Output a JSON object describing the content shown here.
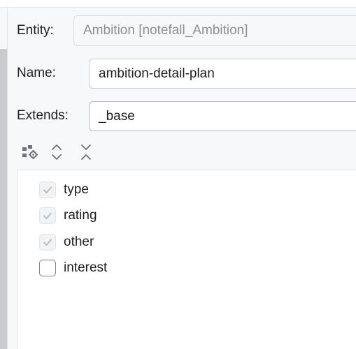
{
  "form": {
    "entity_label": "Entity:",
    "entity_value": "Ambition [notefall_Ambition]",
    "name_label": "Name:",
    "name_value": "ambition-detail-plan",
    "extends_label": "Extends:",
    "extends_value": "_base"
  },
  "toolbar": {
    "icons": [
      "hierarchy-settings-icon",
      "expand-all-icon",
      "collapse-all-icon"
    ]
  },
  "attributes": [
    {
      "label": "type",
      "checked": true,
      "enabled": false
    },
    {
      "label": "rating",
      "checked": true,
      "enabled": false
    },
    {
      "label": "other",
      "checked": true,
      "enabled": false
    },
    {
      "label": "interest",
      "checked": false,
      "enabled": true
    }
  ],
  "colors": {
    "text": "#1f1f1f",
    "muted": "#8c8f94",
    "border": "#c9ccd1",
    "check_disabled": "#b9bcc1"
  }
}
